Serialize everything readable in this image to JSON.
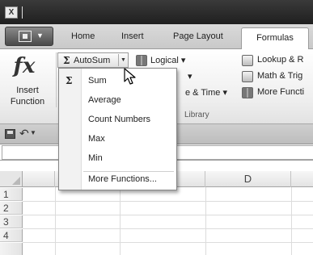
{
  "titlebar": {
    "app_icon": "excel-icon",
    "app_icon_glyph": "X"
  },
  "tabs": {
    "office_button": "office-icon",
    "items": [
      "Home",
      "Insert",
      "Page Layout"
    ],
    "active": "Formulas"
  },
  "ribbon": {
    "insert_function": {
      "icon": "fx",
      "label_line1": "Insert",
      "label_line2": "Function"
    },
    "autosum": {
      "symbol": "Σ",
      "label": "AutoSum"
    },
    "logical": {
      "icon": "book-icon",
      "label": "Logical ▾"
    },
    "lookup": {
      "icon": "lookup-icon",
      "label": "Lookup & R"
    },
    "math": {
      "icon": "math-icon",
      "label": "Math & Trig"
    },
    "col2_row2": "▾",
    "datetime": "e & Time ▾",
    "more_functions": {
      "icon": "book-icon",
      "label": "More Functi"
    },
    "group_label": "Library"
  },
  "autosum_menu": {
    "symbol": "Σ",
    "items": [
      "Sum",
      "Average",
      "Count Numbers",
      "Max",
      "Min",
      "More Functions..."
    ]
  },
  "formula_bar": {
    "fx": "fx"
  },
  "grid": {
    "columns": [
      "C",
      "D"
    ],
    "rows": [
      "1",
      "2",
      "3",
      "4"
    ]
  }
}
